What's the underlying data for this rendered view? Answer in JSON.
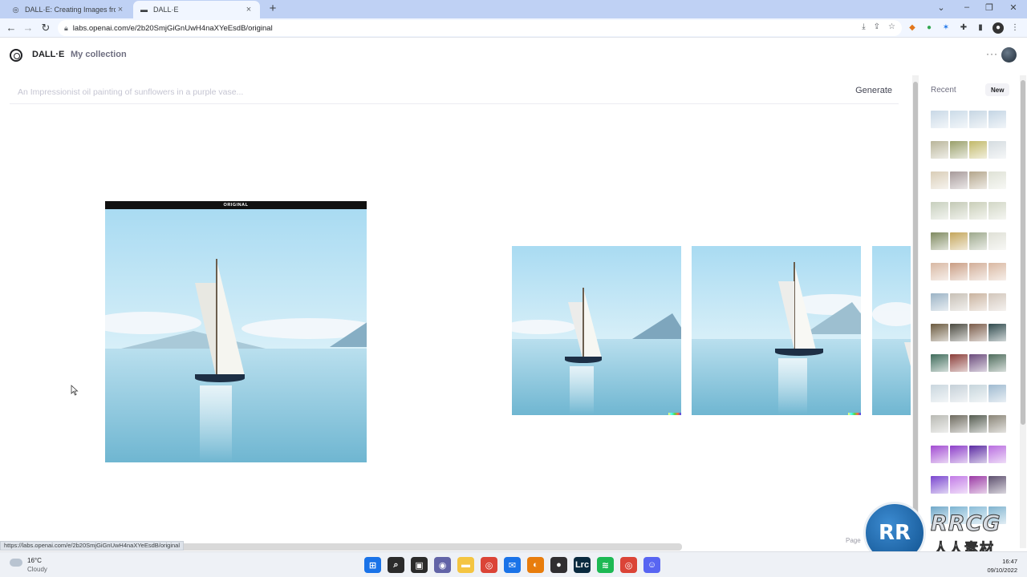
{
  "browser": {
    "tabs": [
      {
        "title": "DALL·E: Creating Images from Te",
        "icon": "openai-icon",
        "active": false
      },
      {
        "title": "DALL·E",
        "icon": "dalle-tab-icon",
        "active": true
      }
    ],
    "url": "labs.openai.com/e/2b20SmjGiGnUwH4naXYeEsdB/original",
    "status_url": "https://labs.openai.com/e/2b20SmjGiGnUwH4naXYeEsdB/original"
  },
  "header": {
    "brand": "DALL·E",
    "nav_link": "My collection",
    "more": "···"
  },
  "prompt": {
    "placeholder": "An Impressionist oil painting of sunflowers in a purple vase...",
    "value": "",
    "button": "Generate"
  },
  "original": {
    "label": "ORIGINAL"
  },
  "sidebar": {
    "title": "Recent",
    "new_button": "New",
    "rows": [
      [
        "#c8d8e6",
        "#cbdbe8",
        "#c6d6e3",
        "#c4d5e4"
      ],
      [
        "#b9b59a",
        "#9aa06b",
        "#c2b96a",
        "#d5dce0"
      ],
      [
        "#d9cdb7",
        "#a79a9a",
        "#b4a68c",
        "#dfe2d6"
      ],
      [
        "#c7cfbd",
        "#c3c9b5",
        "#c9ceb8",
        "#d2d7c6"
      ],
      [
        "#7f8a60",
        "#c4a65c",
        "#9ea98d",
        "#dfe0d6"
      ],
      [
        "#d8b8a3",
        "#c99d83",
        "#d2ae98",
        "#d9b8a2"
      ],
      [
        "#9bb3c5",
        "#c7c0b6",
        "#c9b39f",
        "#d2c6bb"
      ],
      [
        "#6b5a3f",
        "#4b4a40",
        "#7b5c4a",
        "#2f4a4d"
      ],
      [
        "#3f6c5b",
        "#8b3e3a",
        "#6b4b7c",
        "#4f6d5d"
      ],
      [
        "#c9d6de",
        "#c5d0d8",
        "#c6d5dc",
        "#9fbad0"
      ],
      [
        "#b9bab4",
        "#6e6b5f",
        "#555c50",
        "#8a8577"
      ],
      [
        "#a24bd2",
        "#8d3ec9",
        "#5b2aa3",
        "#b96de0"
      ],
      [
        "#7a46cf",
        "#c27be6",
        "#9b3aa5",
        "#5d4f6e"
      ],
      [
        "#6fa8c9",
        "#7cb4d2",
        "#8bbdd8",
        "#7fb3cf"
      ]
    ]
  },
  "watermark": {
    "logo": "RR",
    "text": "RRCG",
    "sub": "人人素材"
  },
  "page_label": "Page",
  "taskbar": {
    "temperature": "16°C",
    "condition": "Cloudy",
    "time": "16:47",
    "date": "09/10/2022",
    "apps": [
      {
        "name": "windows-start-icon",
        "color": "#1a73e8",
        "glyph": "⊞"
      },
      {
        "name": "search-icon",
        "color": "#2b2b2b",
        "glyph": "⌕"
      },
      {
        "name": "task-view-icon",
        "color": "#2b2b2b",
        "glyph": "▣"
      },
      {
        "name": "chat-icon",
        "color": "#6264a7",
        "glyph": "◉"
      },
      {
        "name": "file-explorer-icon",
        "color": "#f4c542",
        "glyph": "▬"
      },
      {
        "name": "chrome-icon",
        "color": "#db4437",
        "glyph": "◎"
      },
      {
        "name": "mail-icon",
        "color": "#1a73e8",
        "glyph": "✉"
      },
      {
        "name": "blender-icon",
        "color": "#e87d0d",
        "glyph": "◐"
      },
      {
        "name": "obs-icon",
        "color": "#302e31",
        "glyph": "●"
      },
      {
        "name": "lightroom-icon",
        "color": "#0a2a3f",
        "glyph": "Lrc"
      },
      {
        "name": "spotify-icon",
        "color": "#1db954",
        "glyph": "≋"
      },
      {
        "name": "chrome-active-icon",
        "color": "#db4437",
        "glyph": "◎"
      },
      {
        "name": "discord-icon",
        "color": "#5865f2",
        "glyph": "☺"
      }
    ]
  }
}
